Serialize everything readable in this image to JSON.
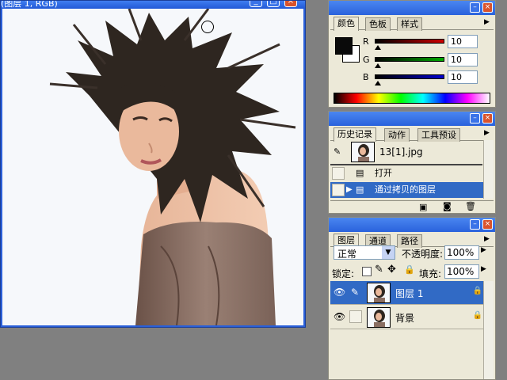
{
  "document": {
    "title": "(图层 1, RGB)"
  },
  "color_palette": {
    "tabs": [
      "颜色",
      "色板",
      "样式"
    ],
    "channels": [
      {
        "label": "R",
        "value": "10",
        "color": "#cc0000"
      },
      {
        "label": "G",
        "value": "10",
        "color": "#00aa00"
      },
      {
        "label": "B",
        "value": "10",
        "color": "#0000cc"
      }
    ],
    "foreground_color": "#0a0a0a",
    "background_color": "#ffffff"
  },
  "history_palette": {
    "tabs": [
      "历史记录",
      "动作",
      "工具预设"
    ],
    "snapshot_name": "13[1].jpg",
    "steps": [
      "打开",
      "通过拷贝的图层"
    ]
  },
  "layers_palette": {
    "tabs": [
      "图层",
      "通道",
      "路径"
    ],
    "blend_mode": "正常",
    "opacity_label": "不透明度:",
    "opacity_value": "100%",
    "lock_label": "锁定:",
    "fill_label": "填充:",
    "fill_value": "100%",
    "layers": [
      "图层 1",
      "背景"
    ]
  },
  "icons": [
    "close-icon",
    "minimize-icon",
    "maximize-icon",
    "eye-icon",
    "brush-icon",
    "lock-icon",
    "move-icon",
    "trash-icon",
    "new-document-icon",
    "camera-icon"
  ]
}
